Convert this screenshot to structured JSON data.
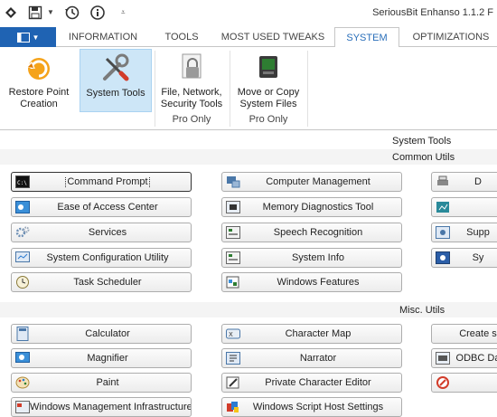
{
  "app": {
    "title": "SeriousBit Enhanso 1.1.2 F"
  },
  "tabs": [
    "INFORMATION",
    "TOOLS",
    "MOST USED TWEAKS",
    "SYSTEM",
    "OPTIMIZATIONS"
  ],
  "active_tab": "SYSTEM",
  "ribbon": {
    "buttons": [
      {
        "label_line1": "Restore Point",
        "label_line2": "Creation",
        "icon": "restore-point-icon"
      },
      {
        "label_line1": "System Tools",
        "label_line2": "",
        "icon": "tools-icon"
      },
      {
        "label_line1": "File, Network,",
        "label_line2": "Security Tools",
        "icon": "lock-file-icon"
      },
      {
        "label_line1": "Move or Copy",
        "label_line2": "System Files",
        "icon": "monitor-icon"
      }
    ],
    "groups": [
      "Pro Only",
      "Pro Only"
    ]
  },
  "content": {
    "header": "System Tools",
    "sections": [
      {
        "title": "Common Utils",
        "col1": [
          "Command Prompt",
          "Ease of Access Center",
          "Services",
          "System Configuration Utility",
          "Task Scheduler"
        ],
        "col2": [
          "Computer Management",
          "Memory Diagnostics Tool",
          "Speech Recognition",
          "System Info",
          "Windows Features"
        ],
        "col3": [
          "D",
          "",
          "Supp",
          "Sy"
        ]
      },
      {
        "title": "Misc. Utils",
        "col1": [
          "Calculator",
          "Magnifier",
          "Paint",
          "Windows Management Infrastructure"
        ],
        "col2": [
          "Character Map",
          "Narrator",
          "Private Character Editor",
          "Windows Script Host Settings"
        ],
        "col3": [
          "Create s",
          "ODBC Da",
          ""
        ]
      }
    ]
  },
  "colors": {
    "accent": "#1f63b3",
    "active_tab_text": "#2a6fba",
    "selected_ribbon": "#cde6f7"
  }
}
